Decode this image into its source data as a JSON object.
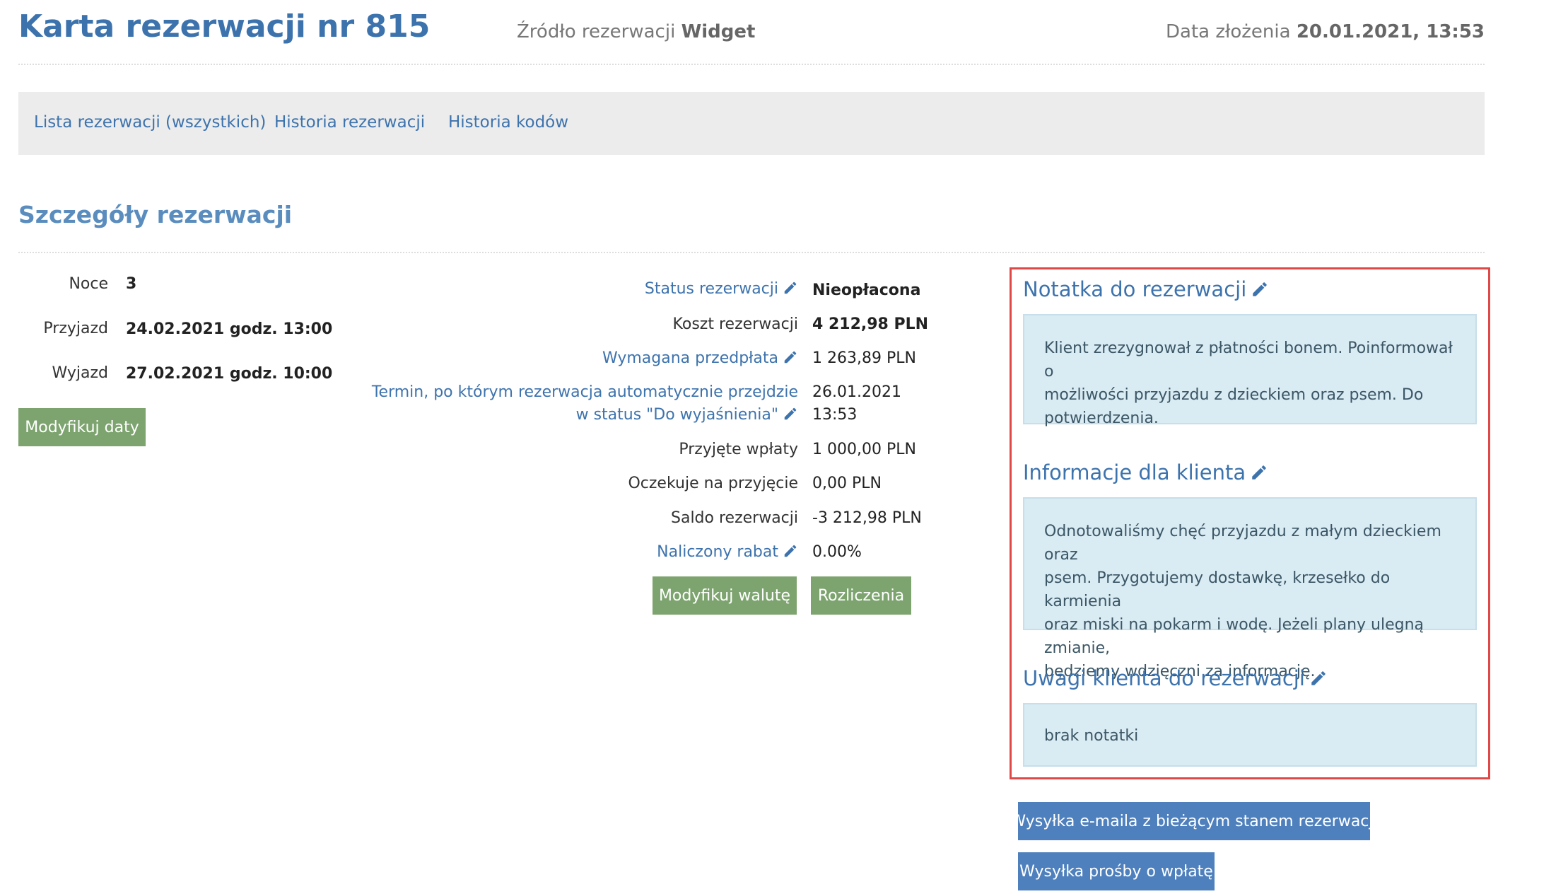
{
  "header": {
    "title": "Karta rezerwacji nr 815",
    "source_label": "Źródło rezerwacji",
    "source_value": "Widget",
    "date_label": "Data złożenia",
    "date_value": "20.01.2021, 13:53"
  },
  "nav": {
    "items": [
      {
        "label": "Lista rezerwacji (wszystkich)"
      },
      {
        "label": "Historia rezerwacji"
      },
      {
        "label": "Historia kodów"
      }
    ]
  },
  "section_title": "Szczegóły rezerwacji",
  "stay": {
    "nights_label": "Noce",
    "nights_value": "3",
    "arrival_label": "Przyjazd",
    "arrival_value": "24.02.2021 godz. 13:00",
    "departure_label": "Wyjazd",
    "departure_value": "27.02.2021 godz. 10:00",
    "modify_dates_button": "Modyfikuj daty"
  },
  "details": {
    "status_label": "Status rezerwacji",
    "status_value": "Nieopłacona",
    "cost_label": "Koszt rezerwacji",
    "cost_value": "4 212,98 PLN",
    "prepayment_label": "Wymagana przedpłata",
    "prepayment_value": "1 263,89 PLN",
    "deadline_label_line1": "Termin, po którym rezerwacja automatycznie przejdzie",
    "deadline_label_line2": "w status \"Do wyjaśnienia\"",
    "deadline_value_date": "26.01.2021",
    "deadline_value_time": "13:53",
    "received_label": "Przyjęte wpłaty",
    "received_value": "1 000,00 PLN",
    "pending_label": "Oczekuje na przyjęcie",
    "pending_value": "0,00 PLN",
    "balance_label": "Saldo rezerwacji",
    "balance_value": "-3 212,98 PLN",
    "discount_label": "Naliczony rabat",
    "discount_value": "0.00%",
    "modify_currency_button": "Modyfikuj walutę",
    "settlements_button": "Rozliczenia"
  },
  "notes": {
    "reservation_note_title": "Notatka do rezerwacji",
    "reservation_note_line1": "Klient zrezygnował z płatności bonem. Poinformował o",
    "reservation_note_line2": "możliwości przyjazdu z dzieckiem oraz psem. Do",
    "reservation_note_line3": "potwierdzenia.",
    "client_info_title": "Informacje dla klienta",
    "client_info_line1": "Odnotowaliśmy chęć przyjazdu z małym dzieckiem oraz",
    "client_info_line2": "psem. Przygotujemy dostawkę, krzesełko do karmienia",
    "client_info_line3": "oraz miski na pokarm i wodę. Jeżeli plany ulegną zmianie,",
    "client_info_line4": "będziemy wdzięczni za informację.",
    "client_remarks_title": "Uwagi klienta do rezerwacji",
    "client_remarks_value": "brak notatki"
  },
  "actions": {
    "send_email_button": "Wysyłka e-maila z bieżącym stanem rezerwacji",
    "send_payment_request_button": "Wysyłka prośby o wpłatę"
  },
  "colors": {
    "link": "#3d73ad",
    "green_button": "#7da46f",
    "blue_button": "#4e80bd",
    "note_background": "#d9ebf3",
    "highlight_border": "#e04848"
  }
}
